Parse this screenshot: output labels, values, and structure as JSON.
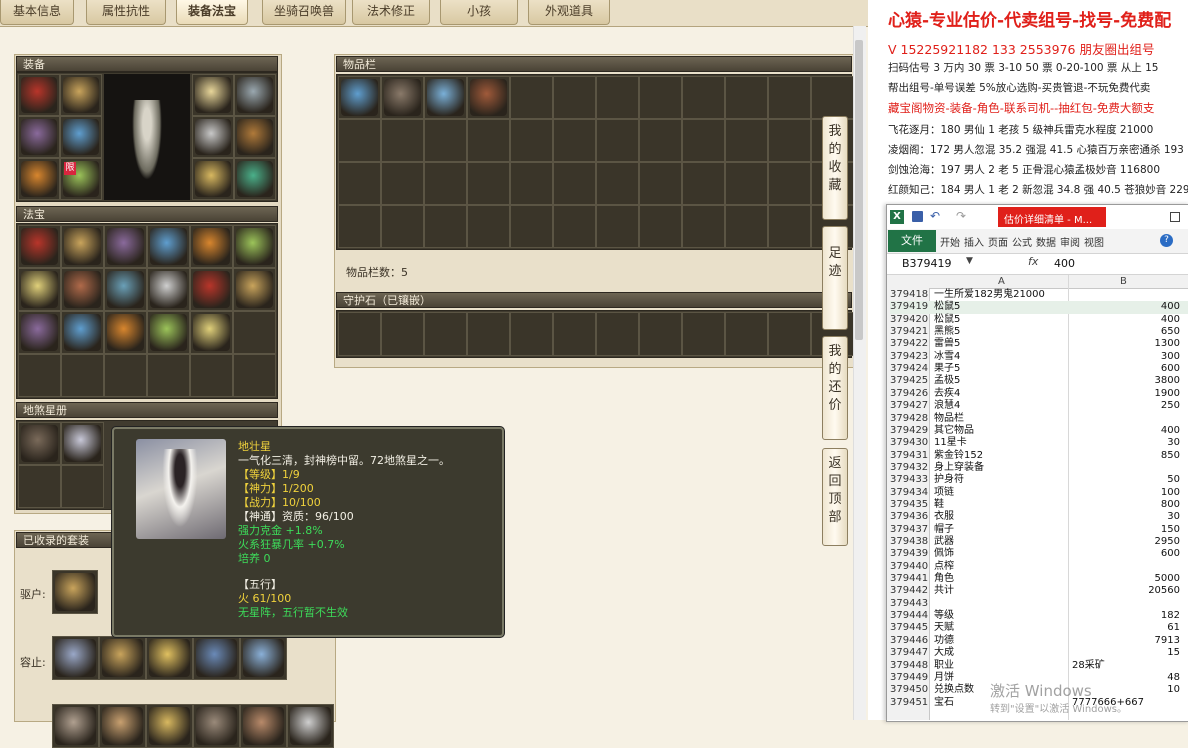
{
  "tabs": [
    "基本信息",
    "属性抗性",
    "装备法宝",
    "坐骑召唤兽",
    "法术修正",
    "小孩",
    "外观道具"
  ],
  "active_tab": "装备法宝",
  "panels": {
    "equipment": "装备",
    "treasure": "法宝",
    "star_brand": "地煞星册",
    "collected_sets": "已收录的套装",
    "inventory": "物品栏",
    "inventory_count": "物品栏数：5",
    "guard_stone": "守护石（已镶嵌）"
  },
  "equip_badge": "限",
  "sets": {
    "label1": "驱户:",
    "label2": "容止:"
  },
  "side_buttons": [
    {
      "label": "我的收藏"
    },
    {
      "label": "足迹"
    },
    {
      "label": "我的还价"
    },
    {
      "label": "返回顶部"
    }
  ],
  "tooltip": {
    "name": "地壮星",
    "desc": "一气化三清，封神榜中留。72地煞星之一。",
    "level": "【等级】1/9",
    "divinity": "【神力】1/200",
    "combat": "【战力】10/100",
    "aptitude": "【神通】资质：96/100",
    "bonus1": "强力克金 +1.8%",
    "bonus2": "火系狂暴几率 +0.7%",
    "cultivate": "培养 0",
    "five_title": "【五行】",
    "five_value": "火 61/100",
    "five_note": "无星阵，五行暂不生效"
  },
  "ad": {
    "title": "心猿-专业估价-代卖组号-找号-免费配",
    "contact": "V 15225921182  133 2553976 朋友圈出组号",
    "line3": "扫码估号 3 万内 30 票 3-10 50 票 0-20-100 票  从上 15",
    "line4": "帮出组号-单号误差 5%放心选购-买贵管退-不玩免费代卖",
    "line5": "藏宝阁物资-装备-角色-联系司机--抽红包-免费大额支",
    "listings": [
      "飞花逐月：180 男仙 1 老孩 5 级神兵雷克水程度 21000",
      "凌烟阁：172 男人忽混 35.2 强混 41.5 心猿百万亲密通杀 193",
      "剑蚀沧海：197 男人 2 老 5 正骨混心猿孟极妙音 116800",
      "红颜知己：184 男人 1 老 2 新忽混 34.8 强 40.5 苍狼妙音 229"
    ]
  },
  "excel": {
    "title": "估价详细清单 - M...",
    "ribbon_tabs": [
      "文件",
      "开始",
      "插入",
      "页面",
      "公式",
      "数据",
      "审阅",
      "视图"
    ],
    "name_box": "B379419",
    "formula_value": "400",
    "col_a": "A",
    "col_b": "B",
    "rows": [
      [
        "379418",
        "一生所爱182男鬼21000",
        ""
      ],
      [
        "379419",
        "松鼠5",
        "400"
      ],
      [
        "379420",
        "松鼠5",
        "400"
      ],
      [
        "379421",
        "黑熊5",
        "650"
      ],
      [
        "379422",
        "雷兽5",
        "1300"
      ],
      [
        "379423",
        "冰雪4",
        "300"
      ],
      [
        "379424",
        "果子5",
        "600"
      ],
      [
        "379425",
        "孟极5",
        "3800"
      ],
      [
        "379426",
        "去疾4",
        "1900"
      ],
      [
        "379427",
        "浪慧4",
        "250"
      ],
      [
        "379428",
        "物品栏",
        ""
      ],
      [
        "379429",
        "其它物品",
        "400"
      ],
      [
        "379430",
        "11星卡",
        "30"
      ],
      [
        "379431",
        "紫金铃152",
        "850"
      ],
      [
        "379432",
        "身上穿装备",
        ""
      ],
      [
        "379433",
        "护身符",
        "50"
      ],
      [
        "379434",
        "项链",
        "100"
      ],
      [
        "379435",
        "鞋",
        "800"
      ],
      [
        "379436",
        "衣服",
        "30"
      ],
      [
        "379437",
        "帽子",
        "150"
      ],
      [
        "379438",
        "武器",
        "2950"
      ],
      [
        "379439",
        "佩饰",
        "600"
      ],
      [
        "379440",
        "点榨",
        ""
      ],
      [
        "379441",
        "角色",
        "5000"
      ],
      [
        "379442",
        "共计",
        "20560"
      ],
      [
        "379443",
        "",
        ""
      ],
      [
        "379444",
        "等级",
        "182"
      ],
      [
        "379445",
        "天赋",
        "61"
      ],
      [
        "379446",
        "功德",
        "7913"
      ],
      [
        "379447",
        "大成",
        "15"
      ],
      [
        "379448",
        "职业",
        "28采矿"
      ],
      [
        "379449",
        "月饼",
        "48"
      ],
      [
        "379450",
        "兑换点数",
        "10"
      ],
      [
        "379451",
        "宝石",
        "7777666+667"
      ]
    ]
  },
  "watermark": {
    "line1": "激活 Windows",
    "line2": "转到\"设置\"以激活 Windows。"
  },
  "colors": {
    "ad_red": "#e0201a",
    "excel_green": "#217346",
    "tooltip_bg": "#3c3a2e",
    "gold_text": "#f0d23c",
    "green_text": "#3ddc5a"
  }
}
